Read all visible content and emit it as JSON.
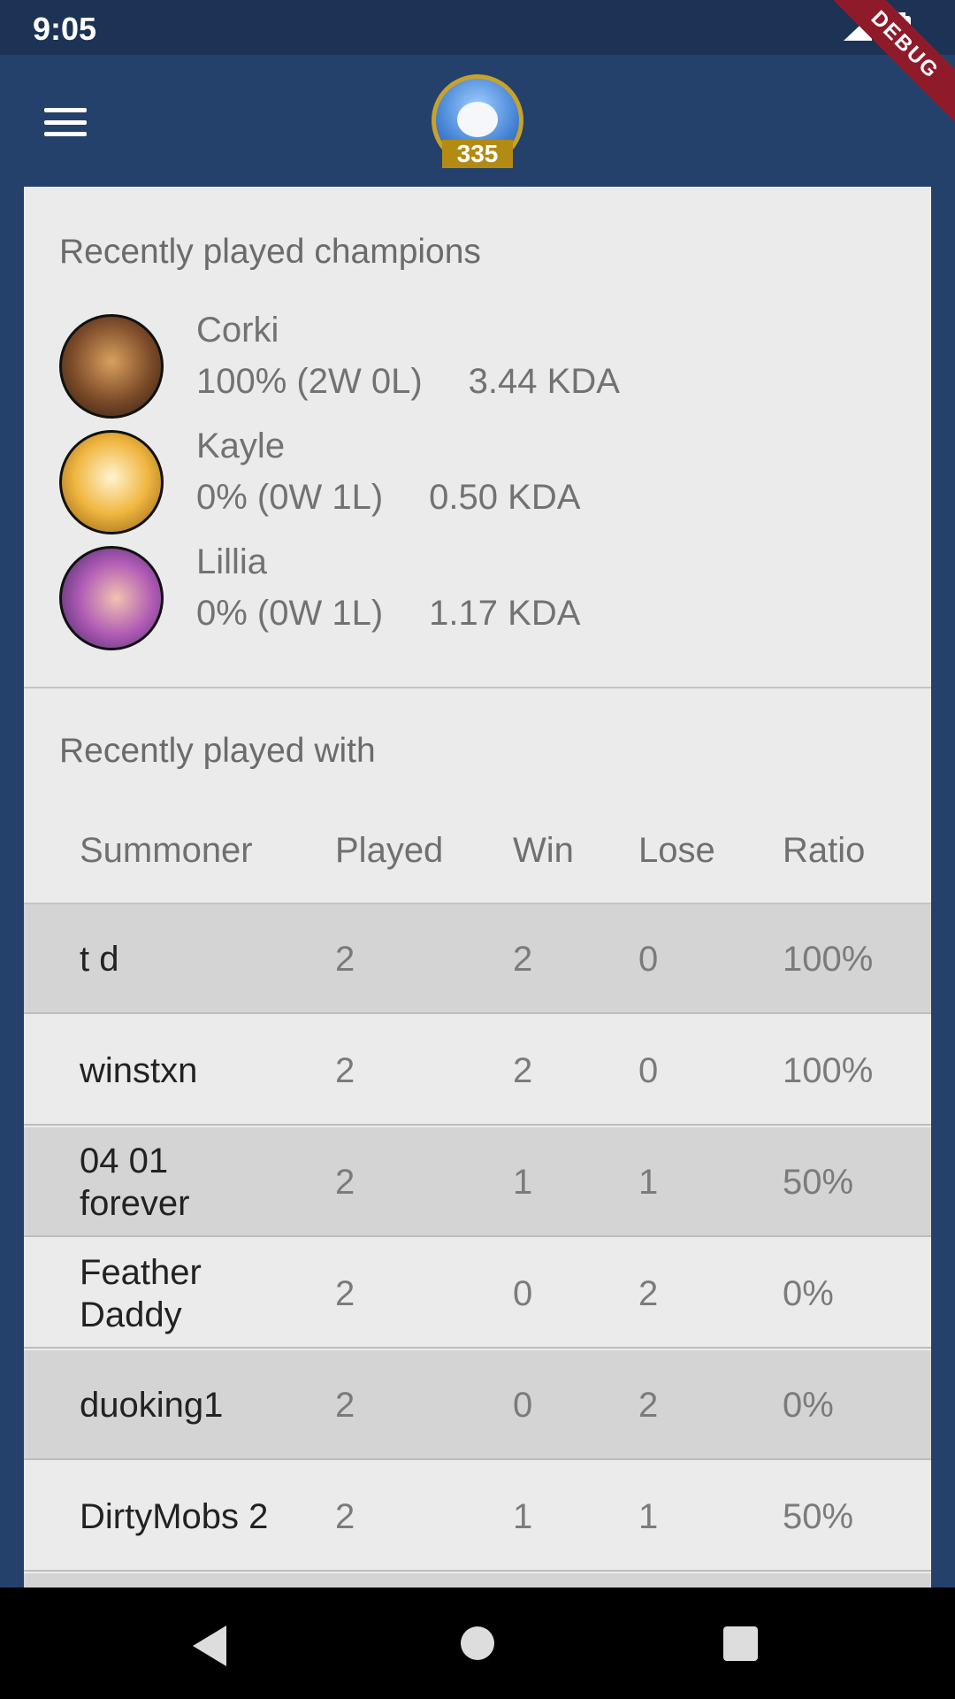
{
  "status_bar": {
    "time": "9:05",
    "icons": [
      "signal-icon",
      "battery-icon"
    ]
  },
  "app_bar": {
    "level": "335",
    "debug_label": "DEBUG"
  },
  "champions_section": {
    "title": "Recently played champions",
    "champions": [
      {
        "name": "Corki",
        "record": "100% (2W 0L)",
        "kda": "3.44 KDA"
      },
      {
        "name": "Kayle",
        "record": "0% (0W 1L)",
        "kda": "0.50 KDA"
      },
      {
        "name": "Lillia",
        "record": "0% (0W 1L)",
        "kda": "1.17 KDA"
      }
    ]
  },
  "played_with_section": {
    "title": "Recently played with",
    "headers": [
      "Summoner",
      "Played",
      "Win",
      "Lose",
      "Ratio"
    ],
    "rows": [
      {
        "summoner": "t d",
        "played": "2",
        "win": "2",
        "lose": "0",
        "ratio": "100%"
      },
      {
        "summoner": "winstxn",
        "played": "2",
        "win": "2",
        "lose": "0",
        "ratio": "100%"
      },
      {
        "summoner": "04 01 forever",
        "played": "2",
        "win": "1",
        "lose": "1",
        "ratio": "50%"
      },
      {
        "summoner": "Feather Daddy",
        "played": "2",
        "win": "0",
        "lose": "2",
        "ratio": "0%"
      },
      {
        "summoner": "duoking1",
        "played": "2",
        "win": "0",
        "lose": "2",
        "ratio": "0%"
      },
      {
        "summoner": "DirtyMobs 2",
        "played": "2",
        "win": "1",
        "lose": "1",
        "ratio": "50%"
      }
    ]
  },
  "colors": {
    "app_bar": "#24416b",
    "status_bar": "#1c3356",
    "card_bg": "#ebebeb",
    "row_alt": "#d4d4d4",
    "level_badge": "#b38a14",
    "debug_banner": "#8f1b2a"
  }
}
